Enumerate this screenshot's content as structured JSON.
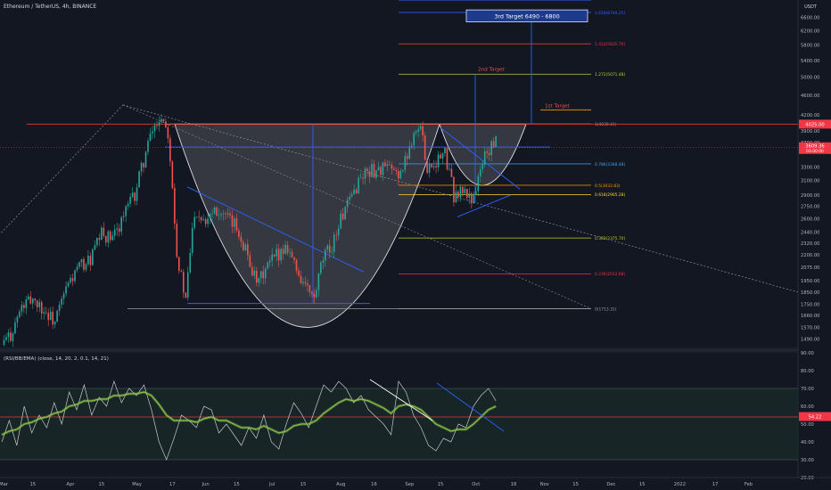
{
  "header": {
    "symbol_line": "Ethereum / TetherUS, 4h, BINANCE"
  },
  "colors": {
    "background": "#131722",
    "candle_up": "#26a69a",
    "candle_down": "#ef5350",
    "trendline": "#2962ff",
    "fib_level": "#d4e157",
    "resistance": "#e53935",
    "cup_fill": "#b0b0b0",
    "rsi_line": "#c8c8c8",
    "rsi_smooth": "#8bc34a",
    "price_badge": "#f23645"
  },
  "chart_data": [
    {
      "type": "candlestick",
      "title": "Ethereum / TetherUS, 4h, BINANCE",
      "currency": "USDT",
      "x_tick_labels": [
        "Mar",
        "15",
        "Apr",
        "15",
        "May",
        "17",
        "Jun",
        "15",
        "Jul",
        "15",
        "Aug",
        "16",
        "Sep",
        "15",
        "Oct",
        "18",
        "Nov",
        "15",
        "Dec",
        "15",
        "2022",
        "17",
        "Feb"
      ],
      "y_tick_labels": [
        "6600.00",
        "6200.00",
        "5800.00",
        "5400.00",
        "5000.00",
        "4600.00",
        "4200.00",
        "3900.00",
        "3700.00",
        "3300.00",
        "3100.00",
        "2900.00",
        "2750.00",
        "2600.00",
        "2440.00",
        "2320.00",
        "2200.00",
        "2075.00",
        "1950.00",
        "1850.00",
        "1750.00",
        "1660.00",
        "1570.00",
        "1490.00"
      ],
      "y_scale": "log",
      "ylim": [
        1420,
        7150
      ],
      "price_path": [
        [
          "Mar 1",
          1450
        ],
        [
          "Mar 5",
          1520
        ],
        [
          "Mar 10",
          1720
        ],
        [
          "Mar 15",
          1800
        ],
        [
          "Mar 20",
          1700
        ],
        [
          "Mar 25",
          1610
        ],
        [
          "Mar 31",
          1920
        ],
        [
          "Apr 5",
          2080
        ],
        [
          "Apr 10",
          2150
        ],
        [
          "Apr 15",
          2420
        ],
        [
          "Apr 20",
          2350
        ],
        [
          "Apr 25",
          2650
        ],
        [
          "Apr 30",
          2900
        ],
        [
          "May 4",
          3400
        ],
        [
          "May 8",
          3900
        ],
        [
          "May 12",
          4200
        ],
        [
          "May 15",
          3900
        ],
        [
          "May 19",
          2200
        ],
        [
          "May 23",
          1760
        ],
        [
          "May 27",
          2700
        ],
        [
          "Jun 1",
          2600
        ],
        [
          "Jun 5",
          2750
        ],
        [
          "Jun 10",
          2600
        ],
        [
          "Jun 15",
          2500
        ],
        [
          "Jun 20",
          2200
        ],
        [
          "Jun 24",
          1900
        ],
        [
          "Jun 28",
          2050
        ],
        [
          "Jul 3",
          2200
        ],
        [
          "Jul 8",
          2300
        ],
        [
          "Jul 12",
          2050
        ],
        [
          "Jul 16",
          1900
        ],
        [
          "Jul 20",
          1780
        ],
        [
          "Jul 24",
          2150
        ],
        [
          "Jul 28",
          2300
        ],
        [
          "Aug 1",
          2600
        ],
        [
          "Aug 5",
          2800
        ],
        [
          "Aug 9",
          3100
        ],
        [
          "Aug 13",
          3250
        ],
        [
          "Aug 17",
          3250
        ],
        [
          "Aug 21",
          3300
        ],
        [
          "Aug 25",
          3200
        ],
        [
          "Aug 29",
          3250
        ],
        [
          "Sep 3",
          3900
        ],
        [
          "Sep 6",
          3950
        ],
        [
          "Sep 9",
          3300
        ],
        [
          "Sep 13",
          3400
        ],
        [
          "Sep 17",
          3500
        ],
        [
          "Sep 21",
          2900
        ],
        [
          "Sep 25",
          2950
        ],
        [
          "Sep 29",
          2850
        ],
        [
          "Oct 2",
          3100
        ],
        [
          "Oct 5",
          3500
        ],
        [
          "Oct 8",
          3600
        ],
        [
          "Oct 10",
          3700
        ]
      ],
      "last_price": "3609.36",
      "last_price_countdown": "03:00:00",
      "resistance_price": "4025.00",
      "fib_levels": [
        {
          "ratio": "1.618",
          "price": "6749.25",
          "label": "1.618(6749.25)"
        },
        {
          "ratio": "1.414",
          "price": "5835.70",
          "label": "1.414(5835.70)"
        },
        {
          "ratio": "1.272",
          "price": "5071.48",
          "label": "1.272(5071.48)"
        },
        {
          "ratio": "1",
          "price": "4030.41",
          "label": "1(4030.41)"
        },
        {
          "ratio": "0.786",
          "price": "3348.48",
          "label": "0.786(3348.48)"
        },
        {
          "ratio": "0.5",
          "price": "3032.83",
          "label": "0.5(3032.83)"
        },
        {
          "ratio": "0.618",
          "price": "2905.28",
          "label": "0.618(2905.28)"
        },
        {
          "ratio": "0.382",
          "price": "2375.70",
          "label": "0.382(2375.70)"
        },
        {
          "ratio": "0.236",
          "price": "2012.68",
          "label": "0.236(2012.68)"
        },
        {
          "ratio": "0",
          "price": "1713.31",
          "label": "0(1713.31)"
        }
      ],
      "annotations": {
        "third_target": "3rd Target  6490  - 6800",
        "second_target": "2nd Target",
        "first_target": "1st Target"
      }
    },
    {
      "type": "line",
      "title": "(RSI/BB/EMA) (close, 14, 20, 2, 0.1, 14, 21)",
      "y_tick_labels": [
        "90.00",
        "80.00",
        "70.00",
        "60.00",
        "50.00",
        "40.00",
        "30.00",
        "20.00"
      ],
      "ylim": [
        20,
        90
      ],
      "upper_band": 70,
      "lower_band": 30,
      "last_value": "54.22",
      "series": [
        {
          "values": [
            40,
            52,
            38,
            60,
            45,
            55,
            48,
            62,
            50,
            68,
            58,
            72,
            55,
            65,
            60,
            74,
            62,
            70,
            66,
            72,
            58,
            40,
            30,
            42,
            55,
            52,
            48,
            60,
            58,
            45,
            50,
            44,
            38,
            48,
            42,
            55,
            40,
            36,
            50,
            62,
            56,
            48,
            60,
            72,
            68,
            74,
            70,
            62,
            66,
            58,
            54,
            50,
            44,
            74,
            68,
            55,
            48,
            38,
            35,
            42,
            40,
            50,
            48,
            60,
            66,
            70,
            63
          ]
        },
        {
          "values": [
            44,
            46,
            47,
            50,
            51,
            53,
            54,
            56,
            57,
            60,
            61,
            63,
            63,
            64,
            64,
            66,
            66,
            67,
            67,
            68,
            66,
            61,
            55,
            52,
            52,
            52,
            51,
            53,
            54,
            52,
            52,
            50,
            48,
            48,
            47,
            49,
            47,
            45,
            46,
            49,
            50,
            50,
            52,
            56,
            59,
            62,
            64,
            63,
            64,
            63,
            61,
            59,
            56,
            60,
            61,
            60,
            58,
            54,
            50,
            48,
            46,
            47,
            47,
            50,
            54,
            58,
            60
          ]
        }
      ]
    }
  ]
}
